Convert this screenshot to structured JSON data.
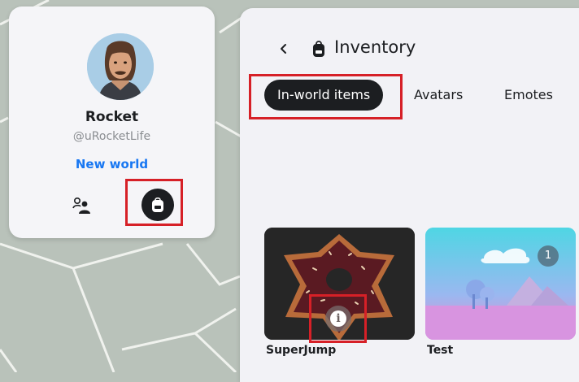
{
  "profile": {
    "name": "Rocket",
    "handle": "@uRocketLife",
    "new_world_label": "New world",
    "friends_icon": "friends-icon",
    "inventory_icon": "backpack-icon"
  },
  "inventory": {
    "title": "Inventory",
    "back_icon": "chevron-left-icon",
    "title_icon": "backpack-icon",
    "tabs": [
      {
        "label": "In-world items",
        "active": true
      },
      {
        "label": "Avatars",
        "active": false
      },
      {
        "label": "Emotes",
        "active": false
      }
    ],
    "items": [
      {
        "name": "SuperJump",
        "info_icon": "info-icon"
      },
      {
        "name": "Test",
        "badge": "1"
      }
    ]
  },
  "colors": {
    "accent": "#1877f2",
    "highlight": "#d62027",
    "dark": "#1c1e21"
  }
}
